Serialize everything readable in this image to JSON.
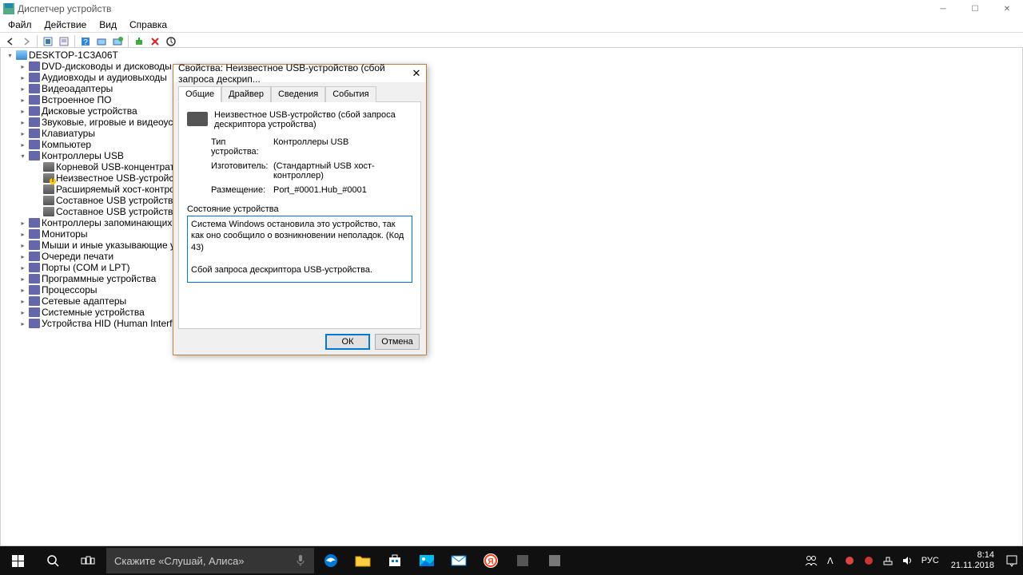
{
  "window": {
    "title": "Диспетчер устройств"
  },
  "menu": [
    "Файл",
    "Действие",
    "Вид",
    "Справка"
  ],
  "tree": {
    "root": "DESKTOP-1C3A06T",
    "categories": [
      {
        "label": "DVD-дисководы и дисководы компа",
        "expanded": false
      },
      {
        "label": "Аудиовходы и аудиовыходы",
        "expanded": false
      },
      {
        "label": "Видеоадаптеры",
        "expanded": false
      },
      {
        "label": "Встроенное ПО",
        "expanded": false
      },
      {
        "label": "Дисковые устройства",
        "expanded": false
      },
      {
        "label": "Звуковые, игровые и видеоустройств",
        "expanded": false
      },
      {
        "label": "Клавиатуры",
        "expanded": false
      },
      {
        "label": "Компьютер",
        "expanded": false
      },
      {
        "label": "Контроллеры USB",
        "expanded": true,
        "children": [
          {
            "label": "Корневой USB-концентратор (USB"
          },
          {
            "label": "Неизвестное USB-устройство (сбо",
            "warn": true
          },
          {
            "label": "Расширяемый хост-контроллер I"
          },
          {
            "label": "Составное USB устройство"
          },
          {
            "label": "Составное USB устройство"
          }
        ]
      },
      {
        "label": "Контроллеры запоминающих устрой",
        "expanded": false
      },
      {
        "label": "Мониторы",
        "expanded": false
      },
      {
        "label": "Мыши и иные указывающие устрой",
        "expanded": false
      },
      {
        "label": "Очереди печати",
        "expanded": false
      },
      {
        "label": "Порты (COM и LPT)",
        "expanded": false
      },
      {
        "label": "Программные устройства",
        "expanded": false
      },
      {
        "label": "Процессоры",
        "expanded": false
      },
      {
        "label": "Сетевые адаптеры",
        "expanded": false
      },
      {
        "label": "Системные устройства",
        "expanded": false
      },
      {
        "label": "Устройства HID (Human Interface Dev",
        "expanded": false
      }
    ]
  },
  "dialog": {
    "title": "Свойства: Неизвестное USB-устройство (сбой запроса дескрип...",
    "tabs": [
      "Общие",
      "Драйвер",
      "Сведения",
      "События"
    ],
    "active_tab": 0,
    "device_name": "Неизвестное USB-устройство (сбой запроса дескриптора устройства)",
    "props": {
      "type_label": "Тип устройства:",
      "type_value": "Контроллеры USB",
      "mfg_label": "Изготовитель:",
      "mfg_value": "(Стандартный USB хост-контроллер)",
      "loc_label": "Размещение:",
      "loc_value": "Port_#0001.Hub_#0001"
    },
    "status_label": "Состояние устройства",
    "status_text": "Система Windows остановила это устройство, так как оно сообщило о возникновении неполадок. (Код 43)\n\nСбой запроса дескриптора USB-устройства.",
    "ok": "ОК",
    "cancel": "Отмена"
  },
  "taskbar": {
    "cortana_placeholder": "Скажите «Слушай, Алиса»",
    "lang": "РУС",
    "time": "8:14",
    "date": "21.11.2018"
  }
}
